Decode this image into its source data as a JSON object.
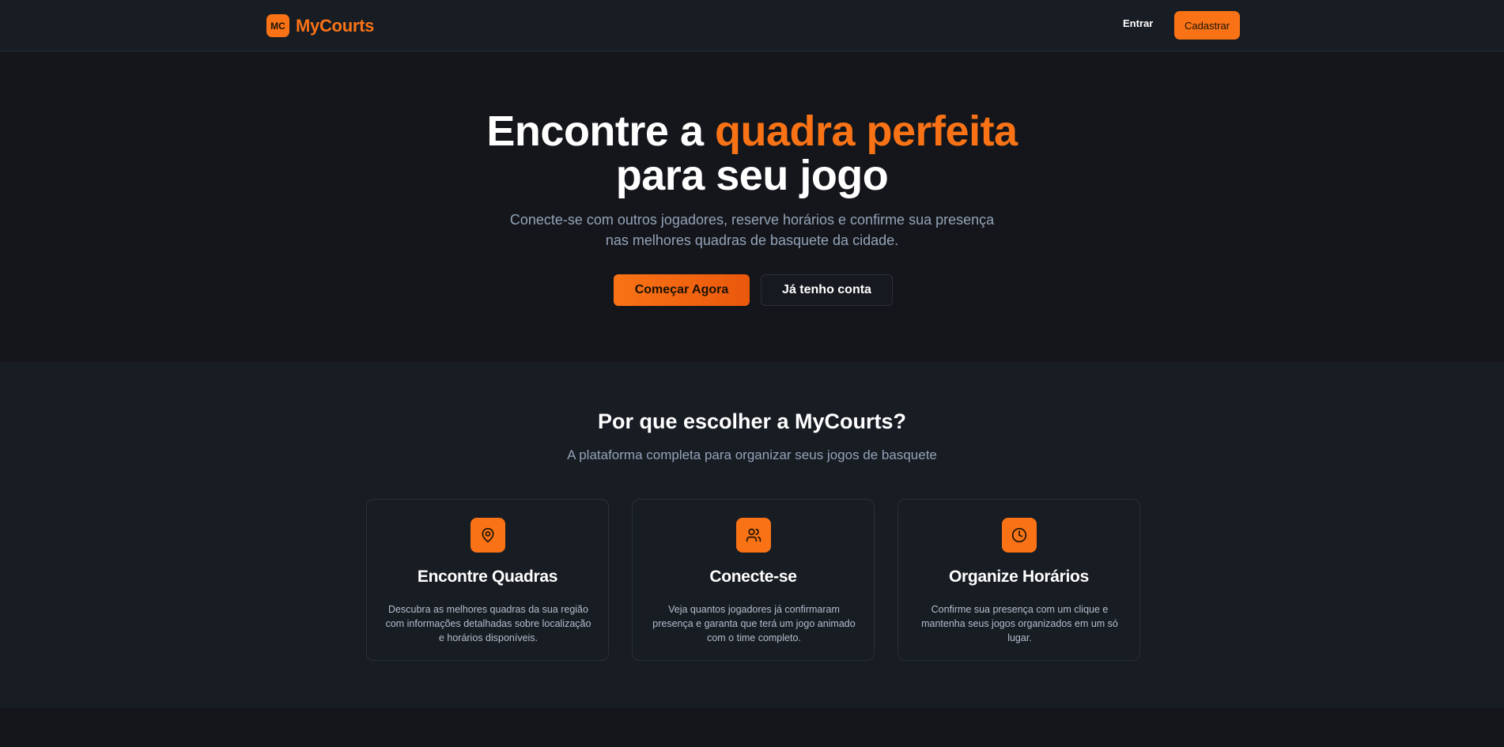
{
  "nav": {
    "brand_badge": "MC",
    "brand_name": "MyCourts",
    "login_label": "Entrar",
    "signup_label": "Cadastrar"
  },
  "hero": {
    "title_part1": "Encontre a ",
    "title_accent": "quadra perfeita",
    "title_part2": "para seu jogo",
    "subtitle_line1": "Conecte-se com outros jogadores, reserve horários e confirme sua presença",
    "subtitle_line2": "nas melhores quadras de basquete da cidade.",
    "primary_button": "Começar Agora",
    "secondary_button": "Já tenho conta"
  },
  "features": {
    "title": "Por que escolher a MyCourts?",
    "subtitle": "A plataforma completa para organizar seus jogos de basquete",
    "cards": [
      {
        "icon": "map-pin-icon",
        "title": "Encontre Quadras",
        "description": "Descubra as melhores quadras da sua região com informações detalhadas sobre localização e horários disponíveis."
      },
      {
        "icon": "users-icon",
        "title": "Conecte-se",
        "description": "Veja quantos jogadores já confirmaram presença e garanta que terá um jogo animado com o time completo."
      },
      {
        "icon": "clock-icon",
        "title": "Organize Horários",
        "description": "Confirme sua presença com um clique e mantenha seus jogos organizados em um só lugar."
      }
    ]
  },
  "colors": {
    "accent": "#f97316",
    "background": "#14161b",
    "surface": "#181c23",
    "muted_text": "#94a3b8"
  }
}
